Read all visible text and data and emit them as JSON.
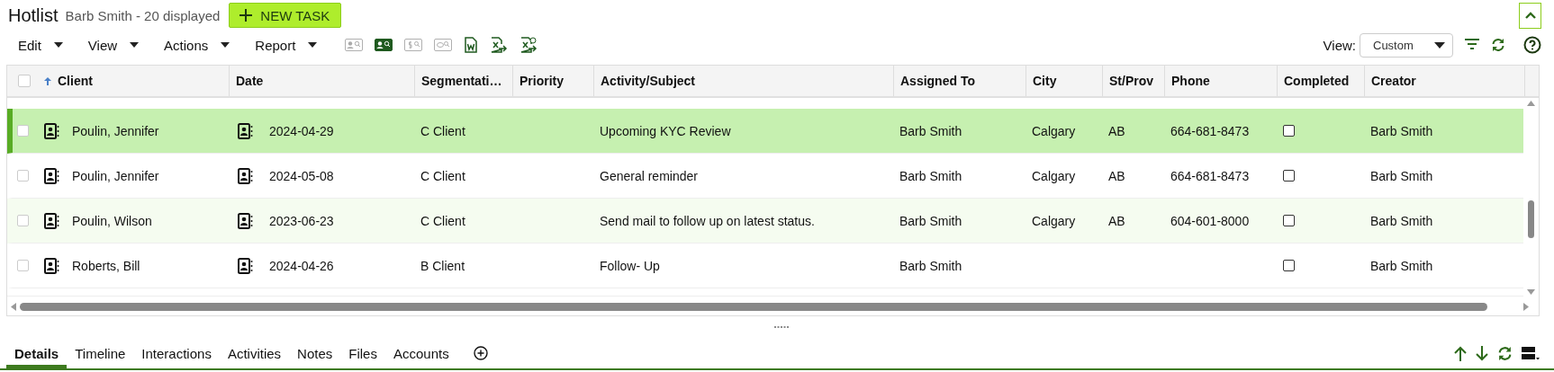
{
  "header": {
    "title": "Hotlist",
    "subtitle": "Barb Smith - 20 displayed",
    "new_task_button": "NEW TASK"
  },
  "toolbar": {
    "menus": [
      "Edit",
      "View",
      "Actions",
      "Report"
    ],
    "tools": [
      {
        "kind": "contact-search",
        "disabled": true
      },
      {
        "kind": "contact-search",
        "disabled": false
      },
      {
        "kind": "dollar-search",
        "disabled": true
      },
      {
        "kind": "chat-search",
        "disabled": true
      },
      {
        "kind": "word",
        "disabled": false
      },
      {
        "kind": "excel-export",
        "disabled": false
      },
      {
        "kind": "excel-add",
        "disabled": false
      }
    ],
    "view_label": "View:",
    "view_value": "Custom"
  },
  "table": {
    "all_checked": false,
    "columns": [
      {
        "label": "Client",
        "sorted": true
      },
      {
        "label": "Date",
        "sorted": false
      },
      {
        "label": "Segmentati…",
        "sorted": false
      },
      {
        "label": "Priority",
        "sorted": false
      },
      {
        "label": "Activity/Subject",
        "sorted": false
      },
      {
        "label": "Assigned To",
        "sorted": false
      },
      {
        "label": "City",
        "sorted": false
      },
      {
        "label": "St/Prov",
        "sorted": false
      },
      {
        "label": "Phone",
        "sorted": false
      },
      {
        "label": "Completed",
        "sorted": false
      },
      {
        "label": "Creator",
        "sorted": false
      }
    ],
    "rows": [
      {
        "checked": false,
        "selected": true,
        "highlighted": false,
        "client": "Poulin, Jennifer",
        "date": "2024-04-29",
        "segmentation": "C Client",
        "activity": "Upcoming KYC Review",
        "assigned_to": "Barb Smith",
        "city": "Calgary",
        "state": "AB",
        "phone": "664-681-8473",
        "completed": false,
        "creator": "Barb Smith"
      },
      {
        "checked": false,
        "selected": false,
        "highlighted": false,
        "client": "Poulin, Jennifer",
        "date": "2024-05-08",
        "segmentation": "C Client",
        "activity": "General reminder",
        "assigned_to": "Barb Smith",
        "city": "Calgary",
        "state": "AB",
        "phone": "664-681-8473",
        "completed": false,
        "creator": "Barb Smith"
      },
      {
        "checked": false,
        "selected": false,
        "highlighted": true,
        "client": "Poulin, Wilson",
        "date": "2023-06-23",
        "segmentation": "C Client",
        "activity": "Send mail to follow up on latest status.",
        "assigned_to": "Barb Smith",
        "city": "Calgary",
        "state": "AB",
        "phone": "604-601-8000",
        "completed": false,
        "creator": "Barb Smith"
      },
      {
        "checked": false,
        "selected": false,
        "highlighted": false,
        "client": "Roberts, Bill",
        "date": "2024-04-26",
        "segmentation": "B Client",
        "activity": "Follow- Up",
        "assigned_to": "Barb Smith",
        "completed": false,
        "creator": "Barb Smith"
      }
    ]
  },
  "tabs": [
    {
      "label": "Details",
      "selected": true
    },
    {
      "label": "Timeline",
      "selected": false
    },
    {
      "label": "Interactions",
      "selected": false
    },
    {
      "label": "Activities",
      "selected": false
    },
    {
      "label": "Notes",
      "selected": false
    },
    {
      "label": "Files",
      "selected": false
    },
    {
      "label": "Accounts",
      "selected": false
    }
  ]
}
